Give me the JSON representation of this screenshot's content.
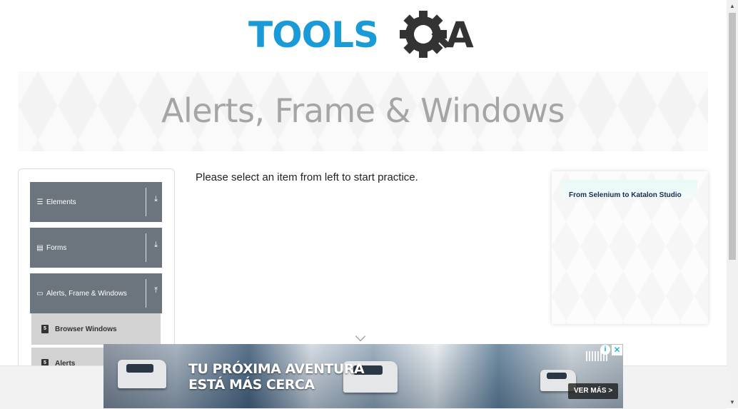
{
  "logo": {
    "text_tools": "TOOLS",
    "text_qa": "QA",
    "colors": {
      "tools": "#1a9ad6",
      "qa": "#333333"
    }
  },
  "banner": {
    "title": "Alerts, Frame & Windows"
  },
  "sidebar": {
    "groups": [
      {
        "label": "Elements",
        "icon": "hamburger-icon",
        "arrow": "download-arrow-icon"
      },
      {
        "label": "Forms",
        "icon": "form-icon",
        "arrow": "download-arrow-icon"
      },
      {
        "label": "Alerts, Frame & Windows",
        "icon": "window-icon",
        "arrow": "upload-arrow-icon"
      }
    ],
    "items": [
      {
        "label": "Browser Windows",
        "icon": "html5-icon"
      },
      {
        "label": "Alerts",
        "icon": "html5-icon"
      }
    ]
  },
  "main": {
    "message": "Please select an item from left to start practice."
  },
  "side_ad": {
    "text": "From Selenium to Katalon Studio"
  },
  "bottom_ad": {
    "headline_line1": "TU PRÓXIMA AVENTURA",
    "headline_line2": "ESTÁ MÁS CERCA",
    "cta": "VER MÁS >",
    "info_icon": "info-icon",
    "close_icon": "close-icon"
  },
  "colors": {
    "sidebar_header_bg": "#6c757d",
    "sub_item_bg": "#d2d2d2",
    "banner_text": "#a5a5a5"
  }
}
